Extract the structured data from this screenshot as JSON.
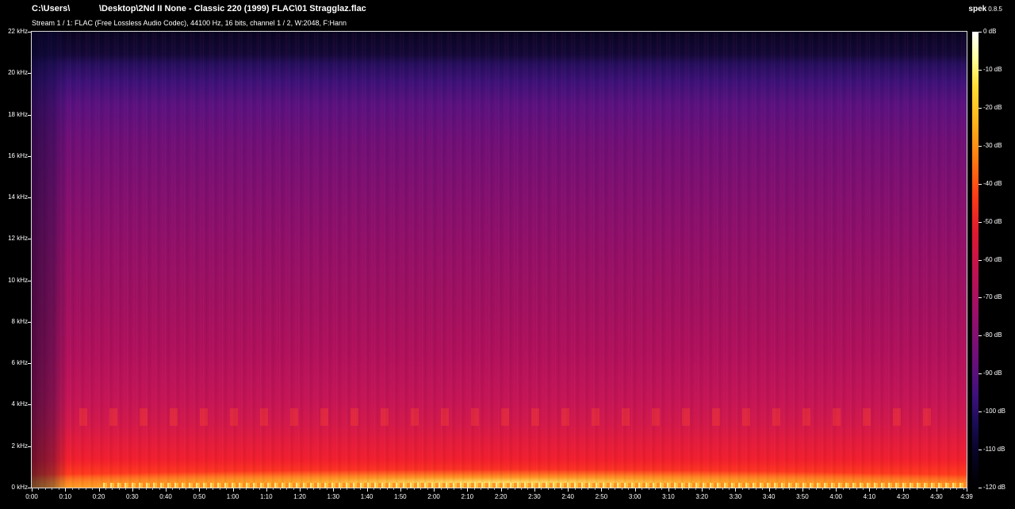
{
  "window": {
    "file_path": "C:\\Users\\            \\Desktop\\2Nd II None - Classic 220 (1999) FLAC\\01 Stragglaz.flac",
    "stream_info": "Stream 1 / 1: FLAC (Free Lossless Audio Codec), 44100 Hz, 16 bits, channel 1 / 2, W:2048, F:Hann",
    "app_name": "spek",
    "app_version": "0.8.5"
  },
  "chart_data": {
    "type": "heatmap",
    "title": "",
    "xlabel": "",
    "ylabel": "",
    "freq_range_khz": [
      0,
      22
    ],
    "freq_ticks": [
      "22 kHz",
      "20 kHz",
      "18 kHz",
      "16 kHz",
      "14 kHz",
      "12 kHz",
      "10 kHz",
      "8 kHz",
      "6 kHz",
      "4 kHz",
      "2 kHz",
      "0 kHz"
    ],
    "time_range_s": [
      0,
      279
    ],
    "time_ticks": [
      "0:00",
      "0:10",
      "0:20",
      "0:30",
      "0:40",
      "0:50",
      "1:00",
      "1:10",
      "1:20",
      "1:30",
      "1:40",
      "1:50",
      "2:00",
      "2:10",
      "2:20",
      "2:30",
      "2:40",
      "2:50",
      "3:00",
      "3:10",
      "3:20",
      "3:30",
      "3:40",
      "3:50",
      "4:00",
      "4:10",
      "4:20",
      "4:30",
      "4:39"
    ],
    "db_range": [
      -120,
      0
    ],
    "db_ticks": [
      "0 dB",
      "-10 dB",
      "-20 dB",
      "-30 dB",
      "-40 dB",
      "-50 dB",
      "-60 dB",
      "-70 dB",
      "-80 dB",
      "-90 dB",
      "-100 dB",
      "-110 dB",
      "-120 dB"
    ],
    "colormap": [
      "#000000",
      "#1a0c55",
      "#6b0f7a",
      "#c1124f",
      "#ff3b16",
      "#ffb21a",
      "#ffff9a",
      "#ffffff"
    ]
  }
}
